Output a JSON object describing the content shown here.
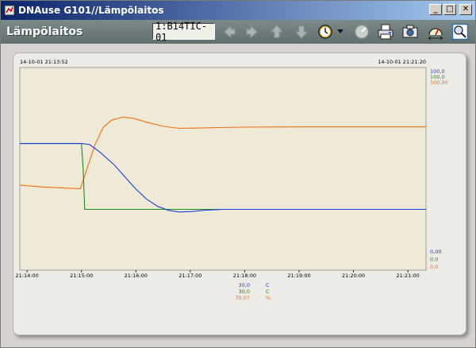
{
  "window": {
    "title": "DNAuse G101//Lämpölaitos",
    "minimize_glyph": "_",
    "maximize_glyph": "□",
    "close_glyph": "✕"
  },
  "toolbar": {
    "page_title": "Lämpölaitos",
    "tag_value": "1:B14TIC-01",
    "icons": [
      "arrow-left-icon",
      "arrow-right-icon",
      "arrow-up-icon",
      "arrow-down-icon",
      "clock-icon",
      "dropdown-arrow-icon",
      "gauge-icon",
      "printer-icon",
      "camera-icon",
      "trend-scale-icon",
      "zoom-icon"
    ]
  },
  "colors": {
    "blue": "#1a3fd4",
    "green": "#1f8a1f",
    "orange": "#f07010",
    "plot_bg": "#efe9d8"
  },
  "chart_data": {
    "type": "line",
    "time_start_label": "14-10-01 21:13:52",
    "time_end_label": "14-10-01 21:21:20",
    "x_ticks": [
      "21:14:00",
      "21:15:00",
      "21:16:00",
      "21:17:00",
      "21:18:00",
      "21:19:00",
      "21:20:00",
      "21:21:00"
    ],
    "x_tick_minutes": [
      0,
      1,
      2,
      3,
      4,
      5,
      6,
      7
    ],
    "x_range_minutes": [
      -0.133,
      7.333
    ],
    "ylim_top_labels": [
      "100,0",
      "100,0",
      "100,00"
    ],
    "ylim_bottom_labels": [
      "0,00",
      "0,0",
      "0,0"
    ],
    "series": [
      {
        "color": "#1a3fd4",
        "ylim": [
          0,
          100
        ],
        "x": [
          -0.133,
          0.2,
          0.5,
          0.8,
          1.0,
          1.15,
          1.35,
          1.6,
          1.8,
          2.0,
          2.2,
          2.4,
          2.6,
          2.8,
          3.0,
          3.3,
          3.6,
          4.0,
          4.5,
          5.0,
          6.0,
          7.333
        ],
        "y": [
          62.5,
          62.5,
          62.5,
          62.5,
          62.5,
          62.0,
          58.0,
          52.0,
          46.0,
          40.0,
          35.0,
          31.5,
          29.5,
          28.7,
          28.9,
          29.6,
          30.0,
          30.0,
          30.0,
          30.0,
          30.0,
          30.0
        ]
      },
      {
        "color": "#1f8a1f",
        "ylim": [
          0,
          100
        ],
        "x": [
          -0.133,
          0.2,
          0.5,
          0.8,
          1.0,
          1.03,
          1.06,
          1.5,
          2.0,
          2.5,
          3.0,
          3.5,
          4.0,
          5.0,
          6.0,
          7.333
        ],
        "y": [
          62.5,
          62.5,
          62.5,
          62.5,
          62.5,
          50.0,
          30.0,
          30.0,
          30.0,
          30.0,
          30.0,
          30.0,
          30.0,
          30.0,
          30.0,
          30.0
        ]
      },
      {
        "color": "#f07010",
        "ylim": [
          0,
          100
        ],
        "x": [
          -0.133,
          0.3,
          0.7,
          0.98,
          1.1,
          1.25,
          1.4,
          1.55,
          1.75,
          1.95,
          2.2,
          2.5,
          2.8,
          3.1,
          3.5,
          4.0,
          5.0,
          6.0,
          7.333
        ],
        "y": [
          42.0,
          41.0,
          40.5,
          40.2,
          50.0,
          62.0,
          70.5,
          74.0,
          75.5,
          75.0,
          73.0,
          71.0,
          70.0,
          70.1,
          70.4,
          70.6,
          70.7,
          70.7,
          70.7
        ]
      }
    ],
    "legend": [
      {
        "value": "30,0",
        "unit": "C",
        "color": "#1a3fd4"
      },
      {
        "value": "30,0",
        "unit": "C",
        "color": "#1f8a1f"
      },
      {
        "value": "70,07",
        "unit": "%",
        "color": "#f07010"
      }
    ]
  }
}
